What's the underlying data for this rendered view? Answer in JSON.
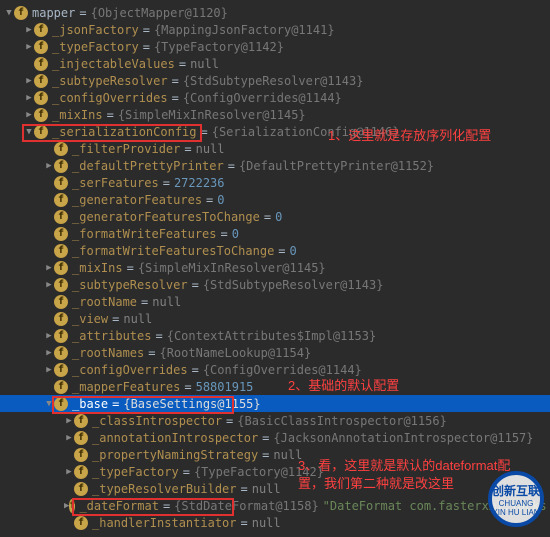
{
  "root": {
    "name": "mapper",
    "val": "{ObjectMapper@1120}"
  },
  "l1": [
    {
      "arrow": "closed",
      "name": "_jsonFactory",
      "val": "{MappingJsonFactory@1141}"
    },
    {
      "arrow": "closed",
      "name": "_typeFactory",
      "val": "{TypeFactory@1142}"
    },
    {
      "arrow": "none",
      "name": "_injectableValues",
      "val": "null",
      "vclass": "null"
    },
    {
      "arrow": "closed",
      "name": "_subtypeResolver",
      "val": "{StdSubtypeResolver@1143}"
    },
    {
      "arrow": "closed",
      "name": "_configOverrides",
      "val": "{ConfigOverrides@1144}"
    },
    {
      "arrow": "closed",
      "name": "_mixIns",
      "val": "{SimpleMixInResolver@1145}"
    }
  ],
  "ser": {
    "name": "_serializationConfig",
    "val": "{SerializationConfig@1146}"
  },
  "l2": [
    {
      "arrow": "none",
      "name": "_filterProvider",
      "val": "null",
      "vclass": "null"
    },
    {
      "arrow": "closed",
      "name": "_defaultPrettyPrinter",
      "val": "{DefaultPrettyPrinter@1152}"
    },
    {
      "arrow": "none",
      "name": "_serFeatures",
      "val": "2722236",
      "vclass": "num"
    },
    {
      "arrow": "none",
      "name": "_generatorFeatures",
      "val": "0",
      "vclass": "num"
    },
    {
      "arrow": "none",
      "name": "_generatorFeaturesToChange",
      "val": "0",
      "vclass": "num"
    },
    {
      "arrow": "none",
      "name": "_formatWriteFeatures",
      "val": "0",
      "vclass": "num"
    },
    {
      "arrow": "none",
      "name": "_formatWriteFeaturesToChange",
      "val": "0",
      "vclass": "num"
    },
    {
      "arrow": "closed",
      "name": "_mixIns",
      "val": "{SimpleMixInResolver@1145}"
    },
    {
      "arrow": "closed",
      "name": "_subtypeResolver",
      "val": "{StdSubtypeResolver@1143}"
    },
    {
      "arrow": "none",
      "name": "_rootName",
      "val": "null",
      "vclass": "null"
    },
    {
      "arrow": "none",
      "name": "_view",
      "val": "null",
      "vclass": "null"
    },
    {
      "arrow": "closed",
      "name": "_attributes",
      "val": "{ContextAttributes$Impl@1153}"
    },
    {
      "arrow": "closed",
      "name": "_rootNames",
      "val": "{RootNameLookup@1154}"
    },
    {
      "arrow": "closed",
      "name": "_configOverrides",
      "val": "{ConfigOverrides@1144}"
    },
    {
      "arrow": "none",
      "name": "_mapperFeatures",
      "val": "58801915",
      "vclass": "num"
    }
  ],
  "base": {
    "name": "_base",
    "val": "{BaseSettings@1155}"
  },
  "l3": [
    {
      "arrow": "closed",
      "name": "_classIntrospector",
      "val": "{BasicClassIntrospector@1156}"
    },
    {
      "arrow": "closed",
      "name": "_annotationIntrospector",
      "val": "{JacksonAnnotationIntrospector@1157}"
    },
    {
      "arrow": "none",
      "name": "_propertyNamingStrategy",
      "val": "null",
      "vclass": "null"
    },
    {
      "arrow": "closed",
      "name": "_typeFactory",
      "val": "{TypeFactory@1142}"
    },
    {
      "arrow": "none",
      "name": "_typeResolverBuilder",
      "val": "null",
      "vclass": "null"
    }
  ],
  "df": {
    "name": "_dateFormat",
    "val": "{StdDateFormat@1158}",
    "extra": "\"DateFormat com.fasterxml.jacks"
  },
  "last": {
    "name": "_handlerInstantiator",
    "val": "null",
    "vclass": "null"
  },
  "anno1": "1、这里就是存放序列化配置",
  "anno2": "2、基础的默认配置",
  "anno3a": "3、看，这里就是默认的dateformat配",
  "anno3b": "置，我们第二种就是改这里",
  "wm1": "创新互联",
  "wm2": "CHUANG XIN HU LIAN"
}
